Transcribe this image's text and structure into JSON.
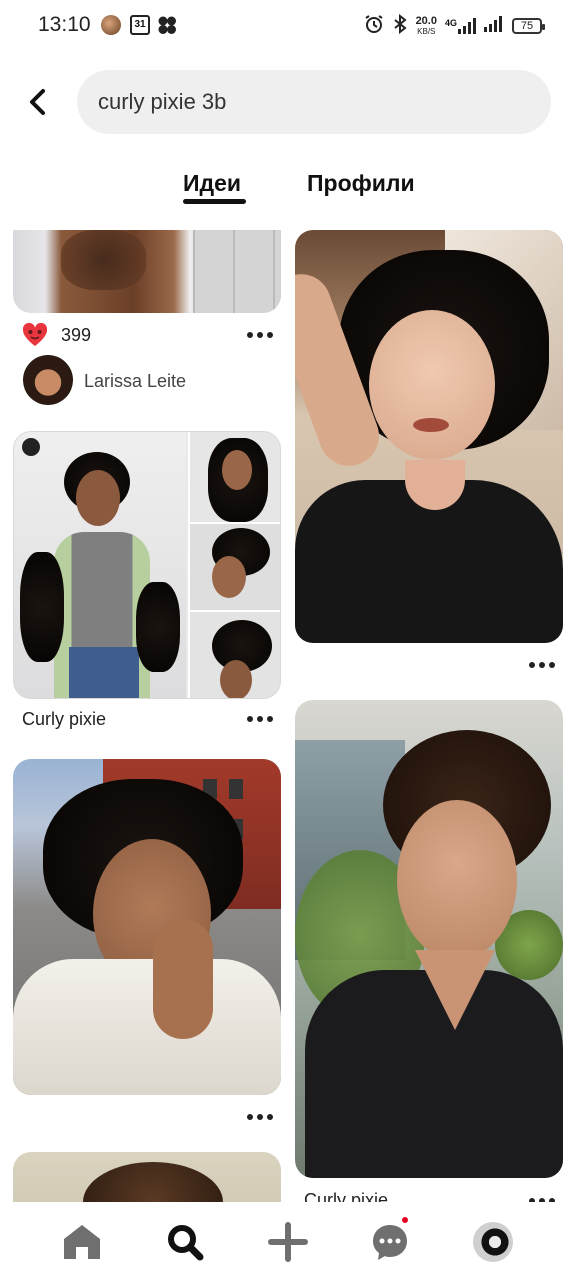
{
  "status_bar": {
    "time": "13:10",
    "calendar_day": "31",
    "net_speed": "20.0",
    "net_unit": "KB/S",
    "network": "4G",
    "battery": "75"
  },
  "search": {
    "query": "curly pixie 3b"
  },
  "tabs": {
    "ideas": "Идеи",
    "profiles": "Профили",
    "active": "ideas"
  },
  "feed": {
    "left_column": [
      {
        "type": "pin",
        "reaction_icon": "heart-eyes-emoji",
        "reaction_count": "399",
        "author": "Larissa Leite"
      },
      {
        "type": "pin",
        "title": "Curly pixie"
      },
      {
        "type": "pin",
        "title": ""
      },
      {
        "type": "pin",
        "title": ""
      }
    ],
    "right_column": [
      {
        "type": "pin",
        "title": ""
      },
      {
        "type": "pin",
        "title": "Curly pixie"
      }
    ]
  },
  "bottom_nav": {
    "items": [
      "home-icon",
      "search-icon",
      "create-icon",
      "messages-icon",
      "profile-avatar"
    ],
    "active": "search-icon",
    "accent": "#e60023"
  }
}
